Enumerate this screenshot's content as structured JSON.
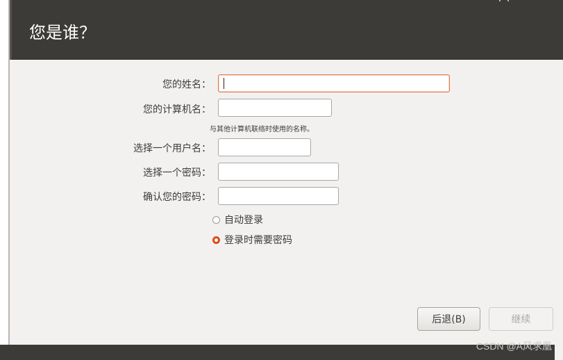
{
  "header": {
    "title": "您是谁？"
  },
  "form": {
    "name_label": "您的姓名：",
    "name_value": "",
    "computer_label": "您的计算机名：",
    "computer_value": "",
    "computer_hint": "与其他计算机联络时使用的名称。",
    "username_label": "选择一个用户名：",
    "username_value": "",
    "password_label": "选择一个密码：",
    "password_value": "",
    "confirm_label": "确认您的密码：",
    "confirm_value": ""
  },
  "login_options": [
    {
      "label": "自动登录",
      "selected": false
    },
    {
      "label": "登录时需要密码",
      "selected": true
    }
  ],
  "buttons": {
    "back": "后退(B)",
    "continue": "继续"
  },
  "watermark": "CSDN @A风求凰",
  "colors": {
    "accent": "#df4a16",
    "header_bg": "#3c3b37",
    "window_bg": "#f2f1f0"
  }
}
